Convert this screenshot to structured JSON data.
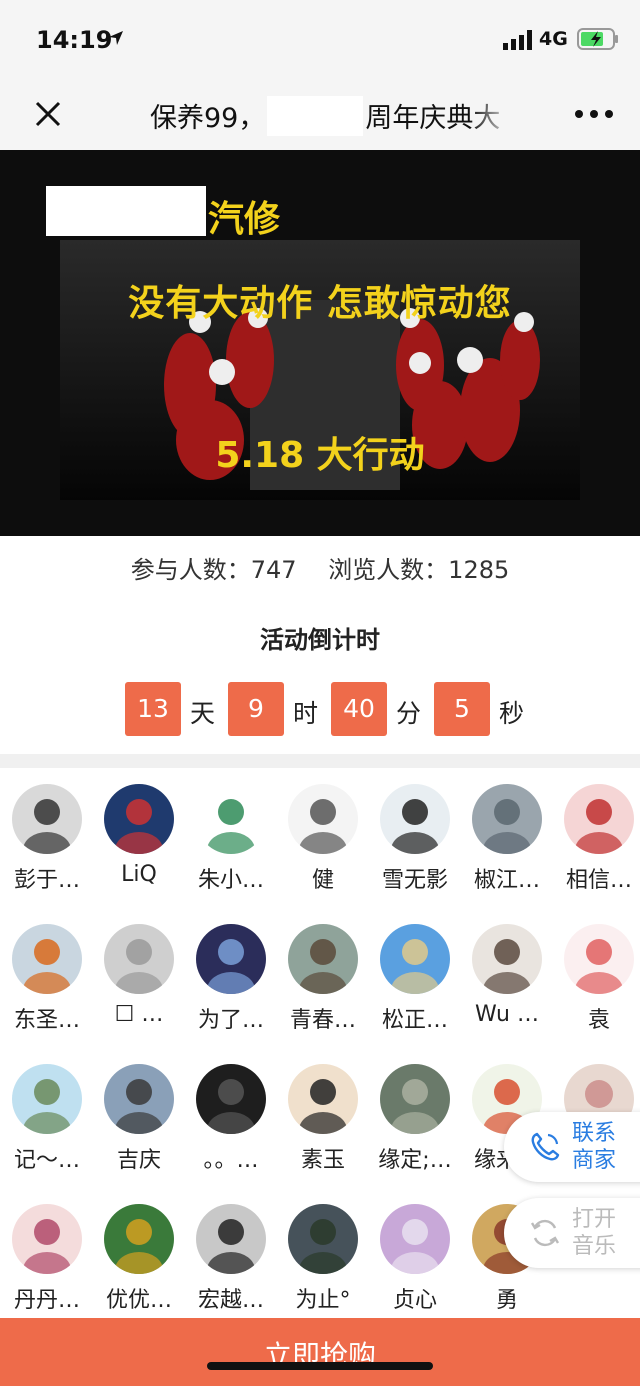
{
  "status_bar": {
    "time": "14:19",
    "network": "4G",
    "location_icon": "location-arrow-icon",
    "signal_icon": "signal-icon",
    "battery_icon": "battery-charging-icon"
  },
  "nav": {
    "title_before": "保养99，",
    "title_after": "周年庆典大",
    "close_icon": "close-icon",
    "more_icon": "more-icon"
  },
  "banner": {
    "brand": "汽修",
    "slogan": "没有大动作 怎敢惊动您",
    "event": "5.18 大行动",
    "accent": "#f3d21c"
  },
  "stats": {
    "participants": "参与人数：747",
    "views": "浏览人数：1285"
  },
  "countdown": {
    "title": "活动倒计时",
    "days": "13",
    "days_unit": "天",
    "hours": "9",
    "hours_unit": "时",
    "minutes": "40",
    "minutes_unit": "分",
    "seconds": "5",
    "seconds_unit": "秒",
    "accent": "#ee6b4a"
  },
  "participants": [
    {
      "name": "彭于…"
    },
    {
      "name": "LiQ"
    },
    {
      "name": "朱小…"
    },
    {
      "name": "健"
    },
    {
      "name": "雪无影"
    },
    {
      "name": "椒江…"
    },
    {
      "name": "相信…"
    },
    {
      "name": "东圣…"
    },
    {
      "name": "☐ …"
    },
    {
      "name": "为了…"
    },
    {
      "name": "青春…"
    },
    {
      "name": "松正…"
    },
    {
      "name": "Wu …"
    },
    {
      "name": "袁"
    },
    {
      "name": "记～…"
    },
    {
      "name": "吉庆"
    },
    {
      "name": "。。…"
    },
    {
      "name": "素玉"
    },
    {
      "name": "缘定;…"
    },
    {
      "name": "缘来…"
    },
    {
      "name": ""
    },
    {
      "name": "丹丹…"
    },
    {
      "name": "优优…"
    },
    {
      "name": "宏越…"
    },
    {
      "name": "为止°"
    },
    {
      "name": "贞心"
    },
    {
      "name": "勇"
    },
    {
      "name": ""
    }
  ],
  "float_buttons": {
    "contact": {
      "line1": "联系",
      "line2": "商家",
      "icon": "phone-icon"
    },
    "music": {
      "line1": "打开",
      "line2": "音乐",
      "icon": "refresh-icon"
    }
  },
  "buy_button": "立即抢购"
}
